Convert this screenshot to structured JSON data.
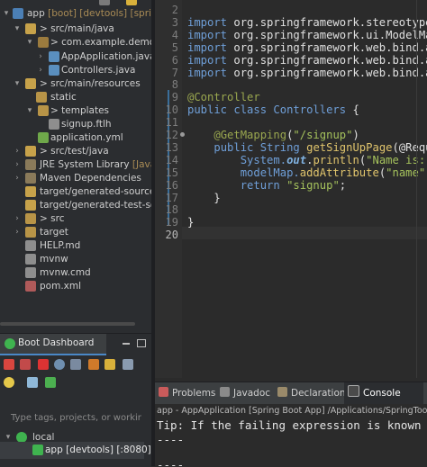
{
  "explorer": {
    "items": [
      {
        "label": "app",
        "suffix": "[boot] [devtools] [sprin"
      },
      {
        "label": "> src/main/java"
      },
      {
        "label": "> com.example.demo"
      },
      {
        "label": "AppApplication.java"
      },
      {
        "label": "Controllers.java"
      },
      {
        "label": "> src/main/resources"
      },
      {
        "label": "static"
      },
      {
        "label": "> templates"
      },
      {
        "label": "signup.ftlh"
      },
      {
        "label": "application.yml"
      },
      {
        "label": "> src/test/java"
      },
      {
        "label": "JRE System Library",
        "suffix": "[JavaS"
      },
      {
        "label": "Maven Dependencies"
      },
      {
        "label": "target/generated-sources/a"
      },
      {
        "label": "target/generated-test-sour"
      },
      {
        "label": "> src"
      },
      {
        "label": "target"
      },
      {
        "label": "HELP.md"
      },
      {
        "label": "mvnw"
      },
      {
        "label": "mvnw.cmd"
      },
      {
        "label": "pom.xml"
      }
    ]
  },
  "boot_dashboard": {
    "title": "Boot Dashboard",
    "filter_placeholder": "Type tags, projects, or workir",
    "group": "local",
    "app": "app [devtools] [:8080]"
  },
  "editor": {
    "lines": [
      {
        "n": "2"
      },
      {
        "n": "3",
        "parts": [
          [
            "kw",
            "import "
          ],
          [
            "",
            "org.springframework.stereotype"
          ]
        ]
      },
      {
        "n": "4",
        "parts": [
          [
            "kw",
            "import "
          ],
          [
            "",
            "org.springframework.ui.ModelMa"
          ]
        ]
      },
      {
        "n": "5",
        "parts": [
          [
            "kw",
            "import "
          ],
          [
            "",
            "org.springframework.web.bind.a"
          ]
        ]
      },
      {
        "n": "6",
        "parts": [
          [
            "kw",
            "import "
          ],
          [
            "",
            "org.springframework.web.bind.a"
          ]
        ]
      },
      {
        "n": "7",
        "parts": [
          [
            "kw",
            "import "
          ],
          [
            "",
            "org.springframework.web.bind.a"
          ]
        ]
      },
      {
        "n": "8"
      },
      {
        "n": "9",
        "parts": [
          [
            "ann",
            "@Controller"
          ]
        ]
      },
      {
        "n": "10",
        "parts": [
          [
            "kw",
            "public class "
          ],
          [
            "kw",
            "Controllers"
          ],
          [
            "",
            " {"
          ]
        ]
      },
      {
        "n": "11"
      },
      {
        "n": "12",
        "parts": [
          [
            "",
            "    "
          ],
          [
            "ann",
            "@GetMapping"
          ],
          [
            "",
            "("
          ],
          [
            "str",
            "\"/signup\""
          ],
          [
            "",
            ")"
          ]
        ]
      },
      {
        "n": "13",
        "parts": [
          [
            "",
            "    "
          ],
          [
            "kw",
            "public "
          ],
          [
            "kw",
            "String "
          ],
          [
            "mth",
            "getSignUpPage"
          ],
          [
            "",
            "(@Requ"
          ]
        ]
      },
      {
        "n": "14",
        "parts": [
          [
            "",
            "        "
          ],
          [
            "kw",
            "System."
          ],
          [
            "fld",
            "out"
          ],
          [
            "",
            "."
          ],
          [
            "mth",
            "println"
          ],
          [
            "",
            "("
          ],
          [
            "str",
            "\"Name is: "
          ]
        ]
      },
      {
        "n": "15",
        "parts": [
          [
            "",
            "        "
          ],
          [
            "kw",
            "modelMap."
          ],
          [
            "mth",
            "addAttribute"
          ],
          [
            "",
            "("
          ],
          [
            "str",
            "\"name\""
          ],
          [
            "",
            ","
          ]
        ]
      },
      {
        "n": "16",
        "parts": [
          [
            "",
            "        "
          ],
          [
            "kw",
            "return "
          ],
          [
            "str",
            "\"signup\""
          ],
          [
            "",
            ";"
          ]
        ]
      },
      {
        "n": "17",
        "parts": [
          [
            "",
            "    }"
          ]
        ]
      },
      {
        "n": "18"
      },
      {
        "n": "19",
        "parts": [
          [
            "",
            "}"
          ]
        ]
      },
      {
        "n": "20"
      }
    ]
  },
  "console": {
    "tabs": [
      "Problems",
      "Javadoc",
      "Declaration",
      "Console"
    ],
    "active_tab": "Console",
    "header": "app - AppApplication [Spring Boot App] /Applications/SpringToolSu",
    "lines": [
      "Tip: If the failing expression is known t",
      "----",
      "",
      "----"
    ]
  }
}
